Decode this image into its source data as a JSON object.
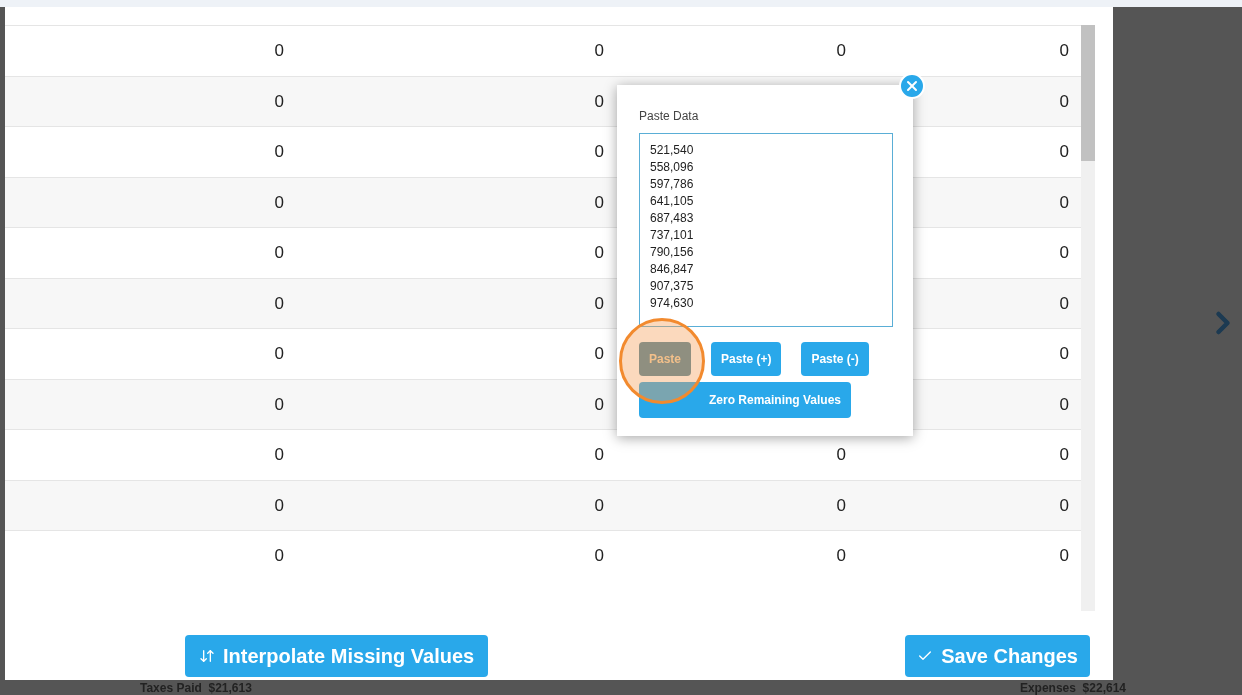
{
  "table": {
    "rows": [
      {
        "column_1": "0",
        "column_2": "0",
        "column_3": "0",
        "column_4": "0"
      },
      {
        "column_1": "0",
        "column_2": "0",
        "column_4": "0"
      },
      {
        "column_1": "0",
        "column_2": "0",
        "column_4": "0"
      },
      {
        "column_1": "0",
        "column_2": "0",
        "column_4": "0"
      },
      {
        "column_1": "0",
        "column_2": "0",
        "column_4": "0"
      },
      {
        "column_1": "0",
        "column_2": "0",
        "column_4": "0"
      },
      {
        "column_1": "0",
        "column_2": "0",
        "column_4": "0"
      },
      {
        "column_1": "0",
        "column_2": "0",
        "column_4": "0"
      },
      {
        "column_1": "0",
        "column_2": "0",
        "column_3": "0",
        "column_4": "0"
      },
      {
        "column_1": "0",
        "column_2": "0",
        "column_3": "0",
        "column_4": "0"
      },
      {
        "column_1": "0",
        "column_2": "0",
        "column_3": "0",
        "column_4": "0"
      }
    ]
  },
  "paste_popup": {
    "label": "Paste Data",
    "values": [
      "521,540",
      "558,096",
      "597,786",
      "641,105",
      "687,483",
      "737,101",
      "790,156",
      "846,847",
      "907,375",
      "974,630"
    ],
    "buttons": [
      {
        "label": "Paste",
        "highlighted": true
      },
      {
        "label": "Paste (+)",
        "highlighted": false
      },
      {
        "label": "Paste (-)",
        "highlighted": false
      }
    ],
    "zero_button": "Zero Remaining Values"
  },
  "footer": {
    "interpolate_button": "Interpolate Missing Values",
    "save_button": "Save Changes"
  },
  "background": {
    "taxes": "Taxes Paid  $21,613",
    "expenses": "Expenses  $22,614"
  }
}
